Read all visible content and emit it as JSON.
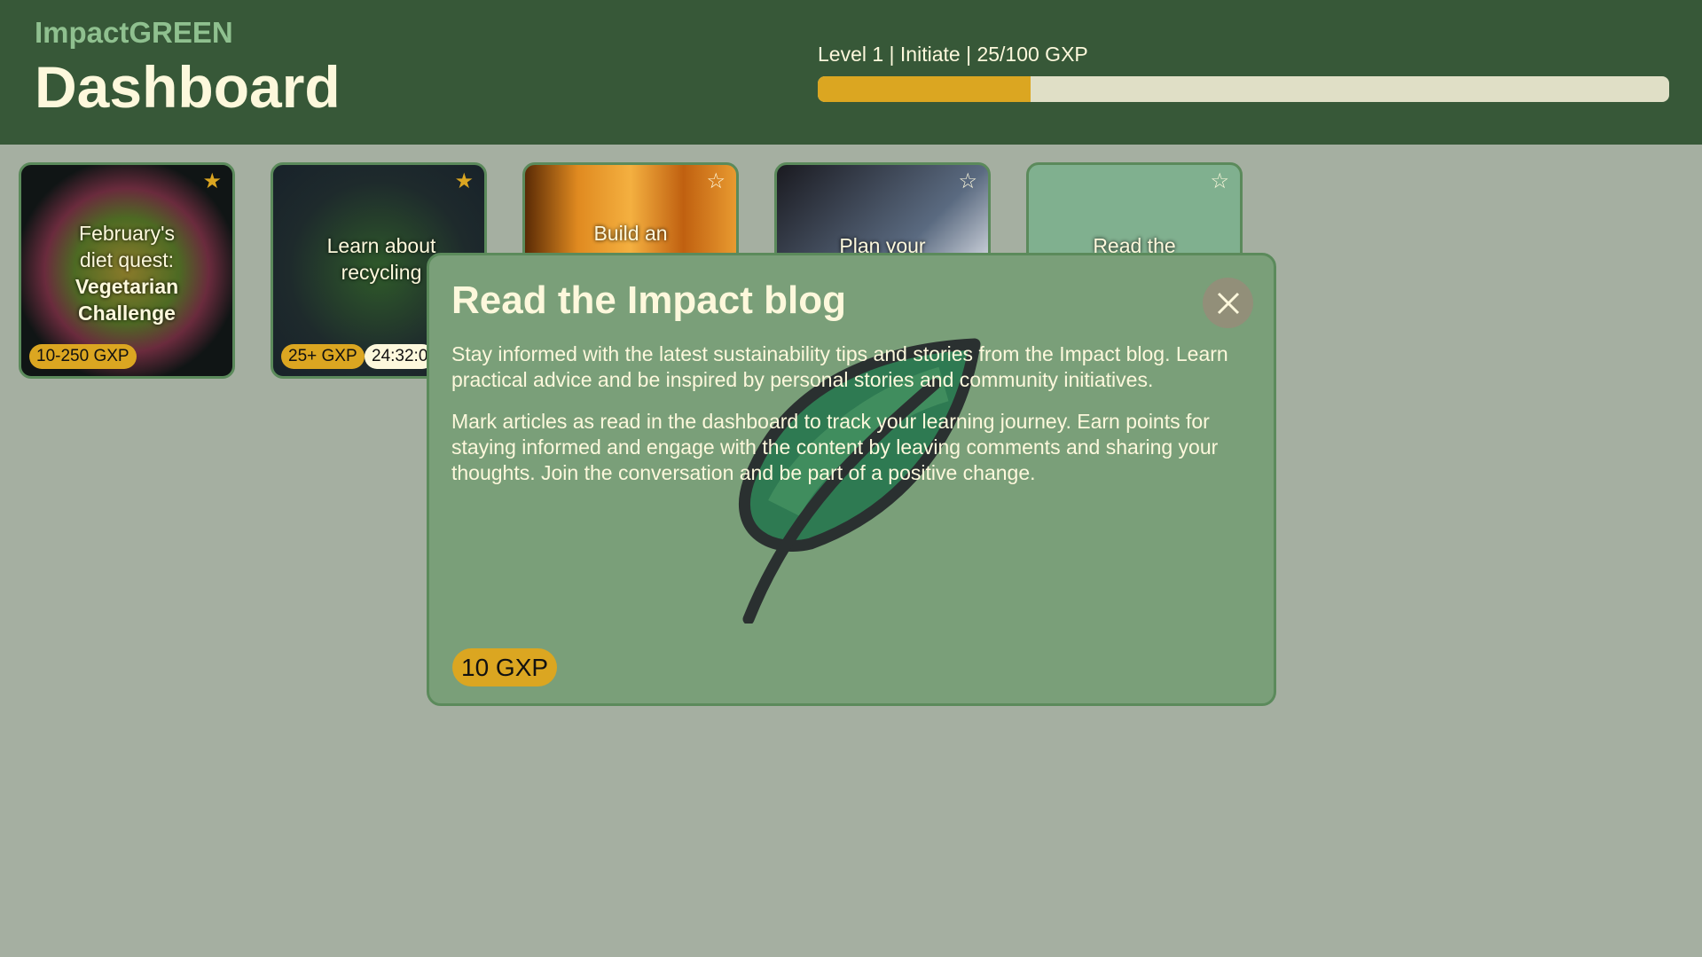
{
  "header": {
    "brand": "ImpactGREEN",
    "title": "Dashboard",
    "level_text": "Level 1 | Initiate | 25/100 GXP",
    "progress_percent": 25,
    "progress_color": "#dba621"
  },
  "cards": [
    {
      "line1": "February's",
      "line2": "diet quest:",
      "line3": "Vegetarian",
      "line4": "Challenge",
      "gxp": "10-250 GXP",
      "starred": true
    },
    {
      "title": "Learn about recycling",
      "gxp": "25+ GXP",
      "timer": "24:32:0",
      "starred": true
    },
    {
      "title": "Build an",
      "starred": false
    },
    {
      "title": "Plan your",
      "starred": false
    },
    {
      "title": "Read the",
      "starred": false
    }
  ],
  "modal": {
    "title": "Read the Impact blog",
    "p1": "Stay informed with the latest sustainability tips and stories from the Impact blog. Learn practical advice and be inspired by personal stories and community initiatives.",
    "p2": "Mark articles as read in the dashboard to track your learning journey. Earn points for staying informed and engage with the content by leaving comments and sharing your thoughts. Join the conversation and be part of a positive change.",
    "gxp": "10 GXP",
    "close_icon": "close-icon"
  }
}
